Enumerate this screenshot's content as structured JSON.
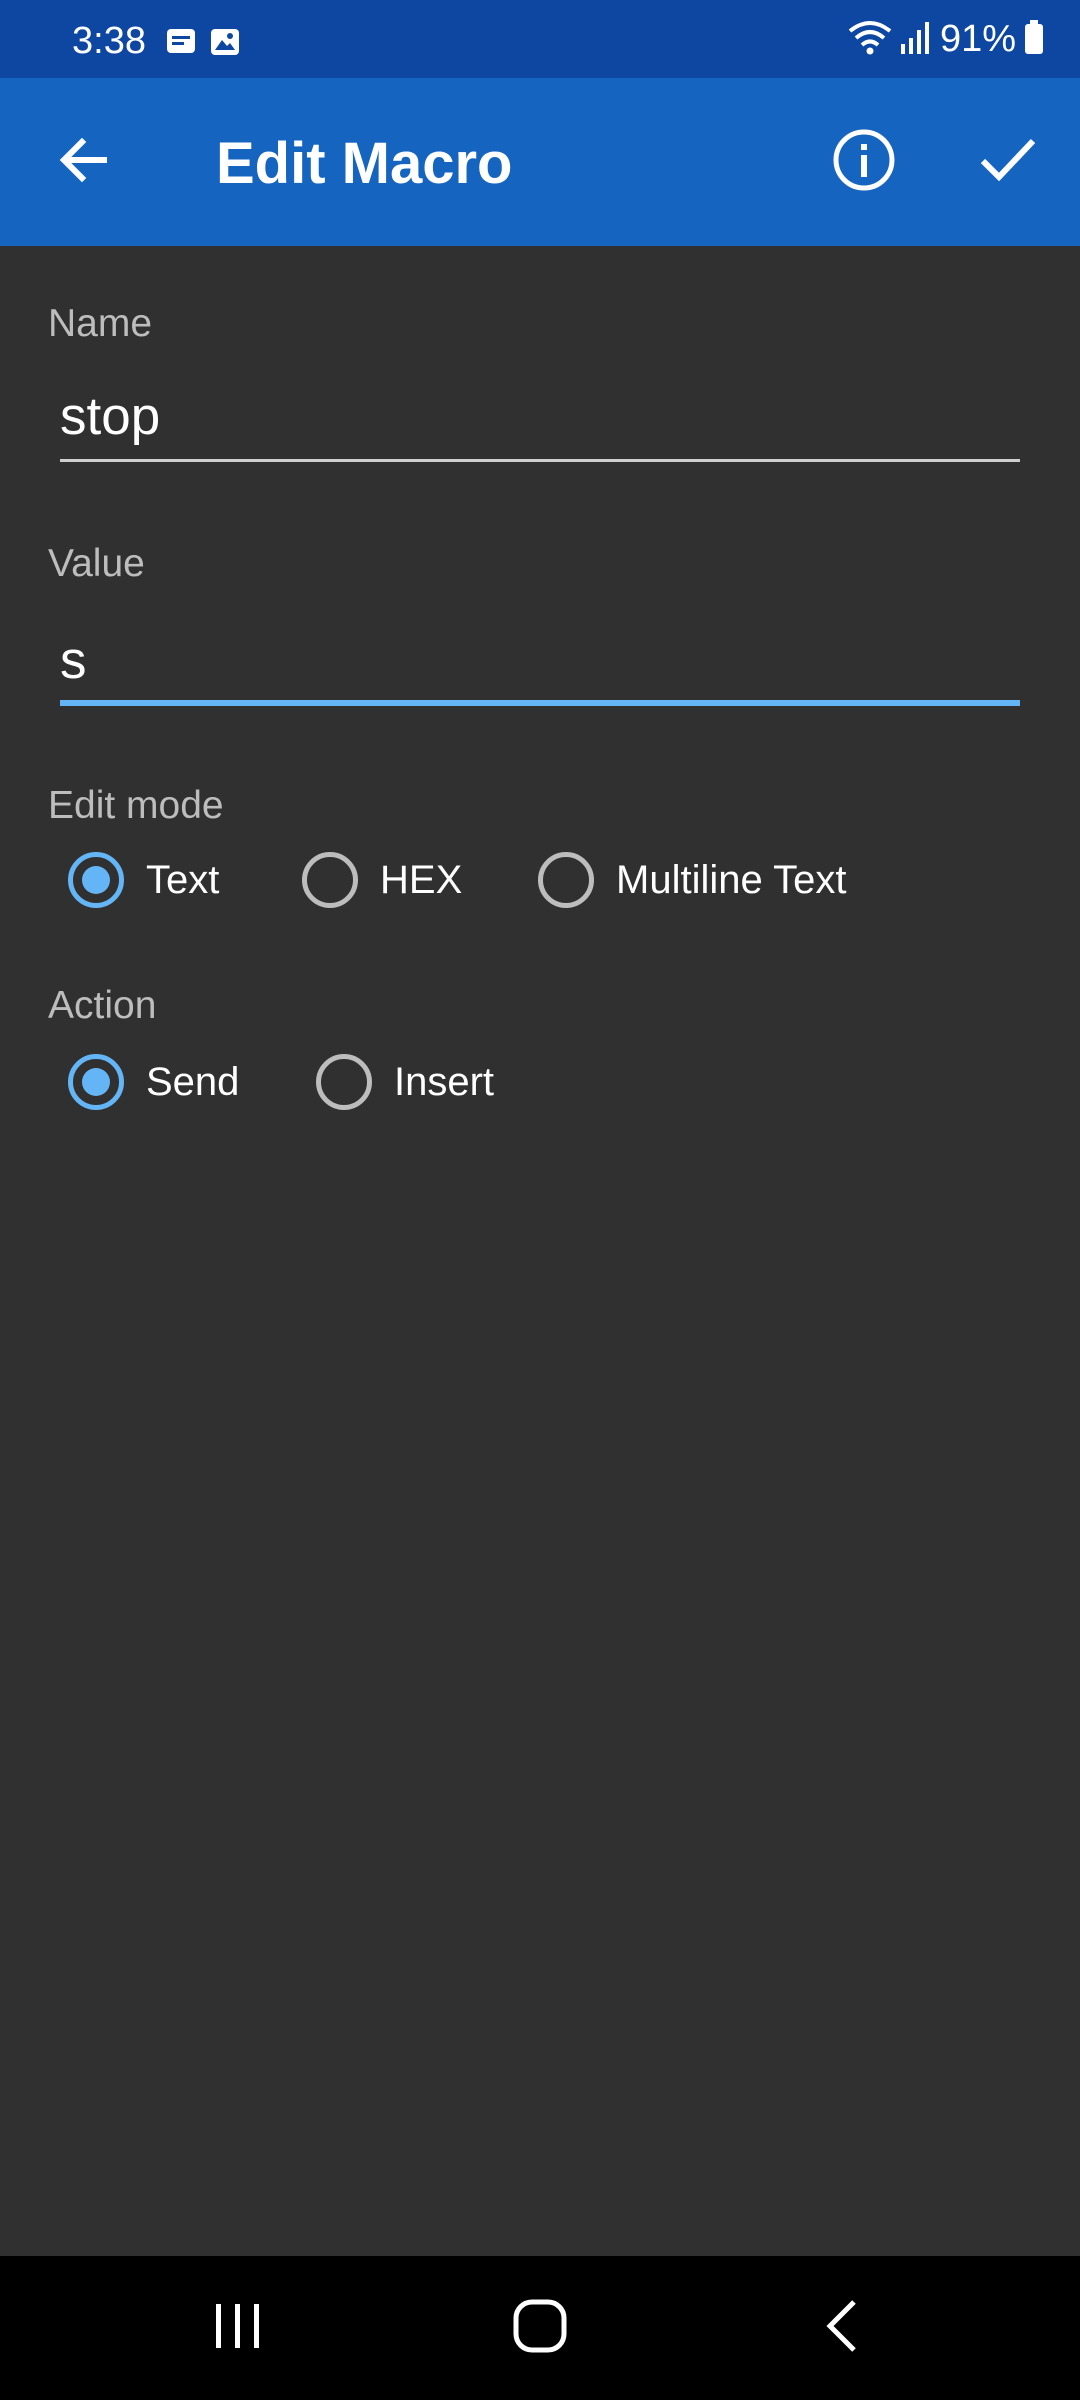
{
  "status_bar": {
    "time": "3:38",
    "battery": "91%"
  },
  "app_bar": {
    "title": "Edit Macro"
  },
  "form": {
    "name_label": "Name",
    "name_value": "stop",
    "value_label": "Value",
    "value_value": "s",
    "edit_mode_label": "Edit mode",
    "edit_modes": [
      {
        "label": "Text",
        "checked": true
      },
      {
        "label": "HEX",
        "checked": false
      },
      {
        "label": "Multiline Text",
        "checked": false
      }
    ],
    "action_label": "Action",
    "actions": [
      {
        "label": "Send",
        "checked": true
      },
      {
        "label": "Insert",
        "checked": false
      }
    ]
  },
  "colors": {
    "status_bar": "#0e47a1",
    "app_bar": "#1565c0",
    "background": "#303030",
    "accent": "#64b5f6"
  }
}
